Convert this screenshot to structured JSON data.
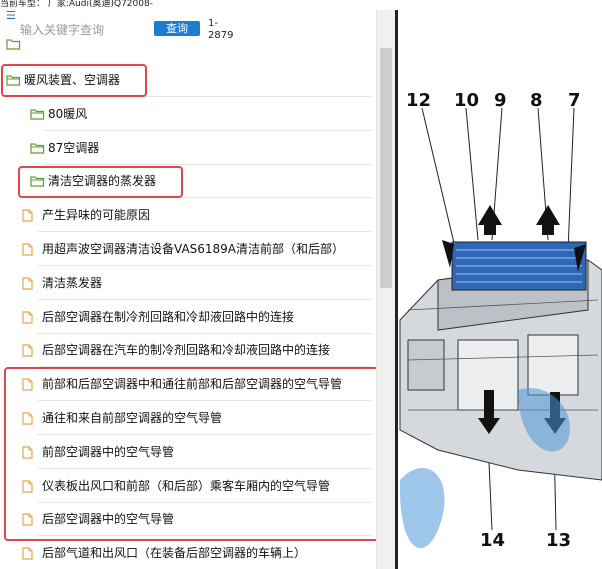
{
  "top_info": "当前车型：  厂家:Audi(奥迪)Q72008-",
  "search": {
    "placeholder": "输入关键字查询",
    "button_label": "查询",
    "page_count": "1-\n2879"
  },
  "tree": {
    "items": [
      {
        "label": "暖风装置、空调器",
        "type": "folder",
        "level": 0
      },
      {
        "label": "80暖风",
        "type": "folder",
        "level": 1
      },
      {
        "label": "87空调器",
        "type": "folder",
        "level": 1
      },
      {
        "label": "清洁空调器的蒸发器",
        "type": "folder",
        "level": 1
      },
      {
        "label": "产生异味的可能原因",
        "type": "doc",
        "level": 2
      },
      {
        "label": "用超声波空调器清洁设备VAS6189A清洁前部（和后部）",
        "type": "doc",
        "level": 2
      },
      {
        "label": "清洁蒸发器",
        "type": "doc",
        "level": 2
      },
      {
        "label": "后部空调器在制冷剂回路和冷却液回路中的连接",
        "type": "doc",
        "level": 2
      },
      {
        "label": "后部空调器在汽车的制冷剂回路和冷却液回路中的连接",
        "type": "doc",
        "level": 2
      },
      {
        "label": "前部和后部空调器中和通往前部和后部空调器的空气导管",
        "type": "doc",
        "level": 2
      },
      {
        "label": "通往和来自前部空调器的空气导管",
        "type": "doc",
        "level": 2
      },
      {
        "label": "前部空调器中的空气导管",
        "type": "doc",
        "level": 2
      },
      {
        "label": "仪表板出风口和前部（和后部）乘客车厢内的空气导管",
        "type": "doc",
        "level": 2
      },
      {
        "label": "后部空调器中的空气导管",
        "type": "doc",
        "level": 2
      },
      {
        "label": "后部气道和出风口（在装备后部空调器的车辆上）",
        "type": "doc",
        "level": 2
      }
    ]
  },
  "diagram": {
    "callouts": [
      "12",
      "10",
      "9",
      "8",
      "7",
      "14",
      "13"
    ]
  },
  "colors": {
    "highlight": "#e0474c",
    "button": "#1a7fd0",
    "folder": "#5aa02c",
    "doc": "#e8a84a"
  }
}
